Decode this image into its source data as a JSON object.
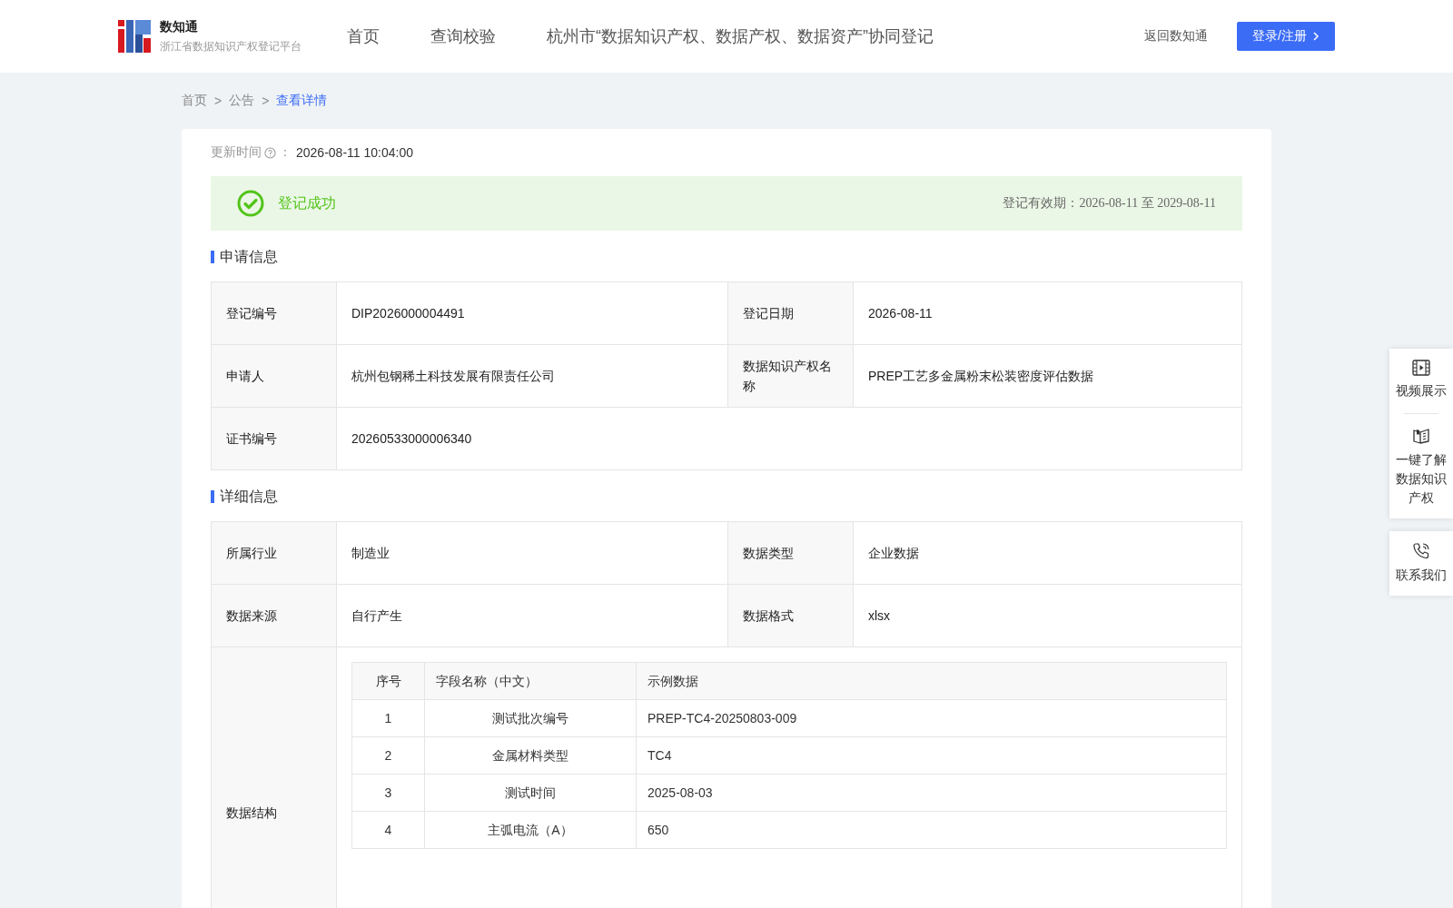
{
  "header": {
    "logo_title": "数知通",
    "logo_subtitle": "浙江省数据知识产权登记平台",
    "nav": [
      {
        "label": "首页",
        "selected": false
      },
      {
        "label": "查询校验",
        "selected": false
      },
      {
        "label": "杭州市“数据知识产权、数据产权、数据资产”协同登记",
        "selected": false
      }
    ],
    "back_link": "返回数知通",
    "login_button": "登录/注册"
  },
  "breadcrumb": [
    {
      "label": "首页",
      "selected": false
    },
    {
      "label": "公告",
      "selected": false
    },
    {
      "label": "查看详情",
      "selected": true
    }
  ],
  "breadcrumb_separator": ">",
  "update": {
    "label": "更新时间",
    "colon": "：",
    "value": "2026-08-11 10:04:00"
  },
  "status": {
    "kind": "success",
    "text": "登记成功",
    "validity": "登记有效期：2026-08-11 至 2029-08-11"
  },
  "apply_section": {
    "title": "申请信息",
    "rows": [
      {
        "cells": [
          {
            "label": "登记编号",
            "value": "DIP2026000004491"
          },
          {
            "label": "登记日期",
            "value": "2026-08-11"
          }
        ]
      },
      {
        "cells": [
          {
            "label": "申请人",
            "value": "杭州包钢稀土科技发展有限责任公司"
          },
          {
            "label": "数据知识产权名称",
            "value": "PREP工艺多金属粉末松装密度评估数据"
          }
        ]
      },
      {
        "cells": [
          {
            "label": "证书编号",
            "value": "20260533000006340"
          }
        ]
      }
    ]
  },
  "detail_section": {
    "title": "详细信息",
    "rows": [
      {
        "cells": [
          {
            "label": "所属行业",
            "value": "制造业"
          },
          {
            "label": "数据类型",
            "value": "企业数据"
          }
        ]
      },
      {
        "cells": [
          {
            "label": "数据来源",
            "value": "自行产生"
          },
          {
            "label": "数据格式",
            "value": "xlsx"
          }
        ]
      }
    ],
    "structure": {
      "label": "数据结构",
      "columns": [
        "序号",
        "字段名称（中文）",
        "示例数据"
      ],
      "rows": [
        [
          "1",
          "测试批次编号",
          "PREP-TC4-20250803-009"
        ],
        [
          "2",
          "金属材料类型",
          "TC4"
        ],
        [
          "3",
          "测试时间",
          "2025-08-03"
        ],
        [
          "4",
          "主弧电流（A）",
          "650"
        ]
      ]
    }
  },
  "side_panel": [
    {
      "kind": "video",
      "lines": [
        "视频展示"
      ]
    },
    {
      "kind": "book",
      "lines": [
        "一键了解",
        "数据知识",
        "产权"
      ]
    },
    {
      "kind": "phone",
      "lines": [
        "联系我们"
      ]
    }
  ]
}
